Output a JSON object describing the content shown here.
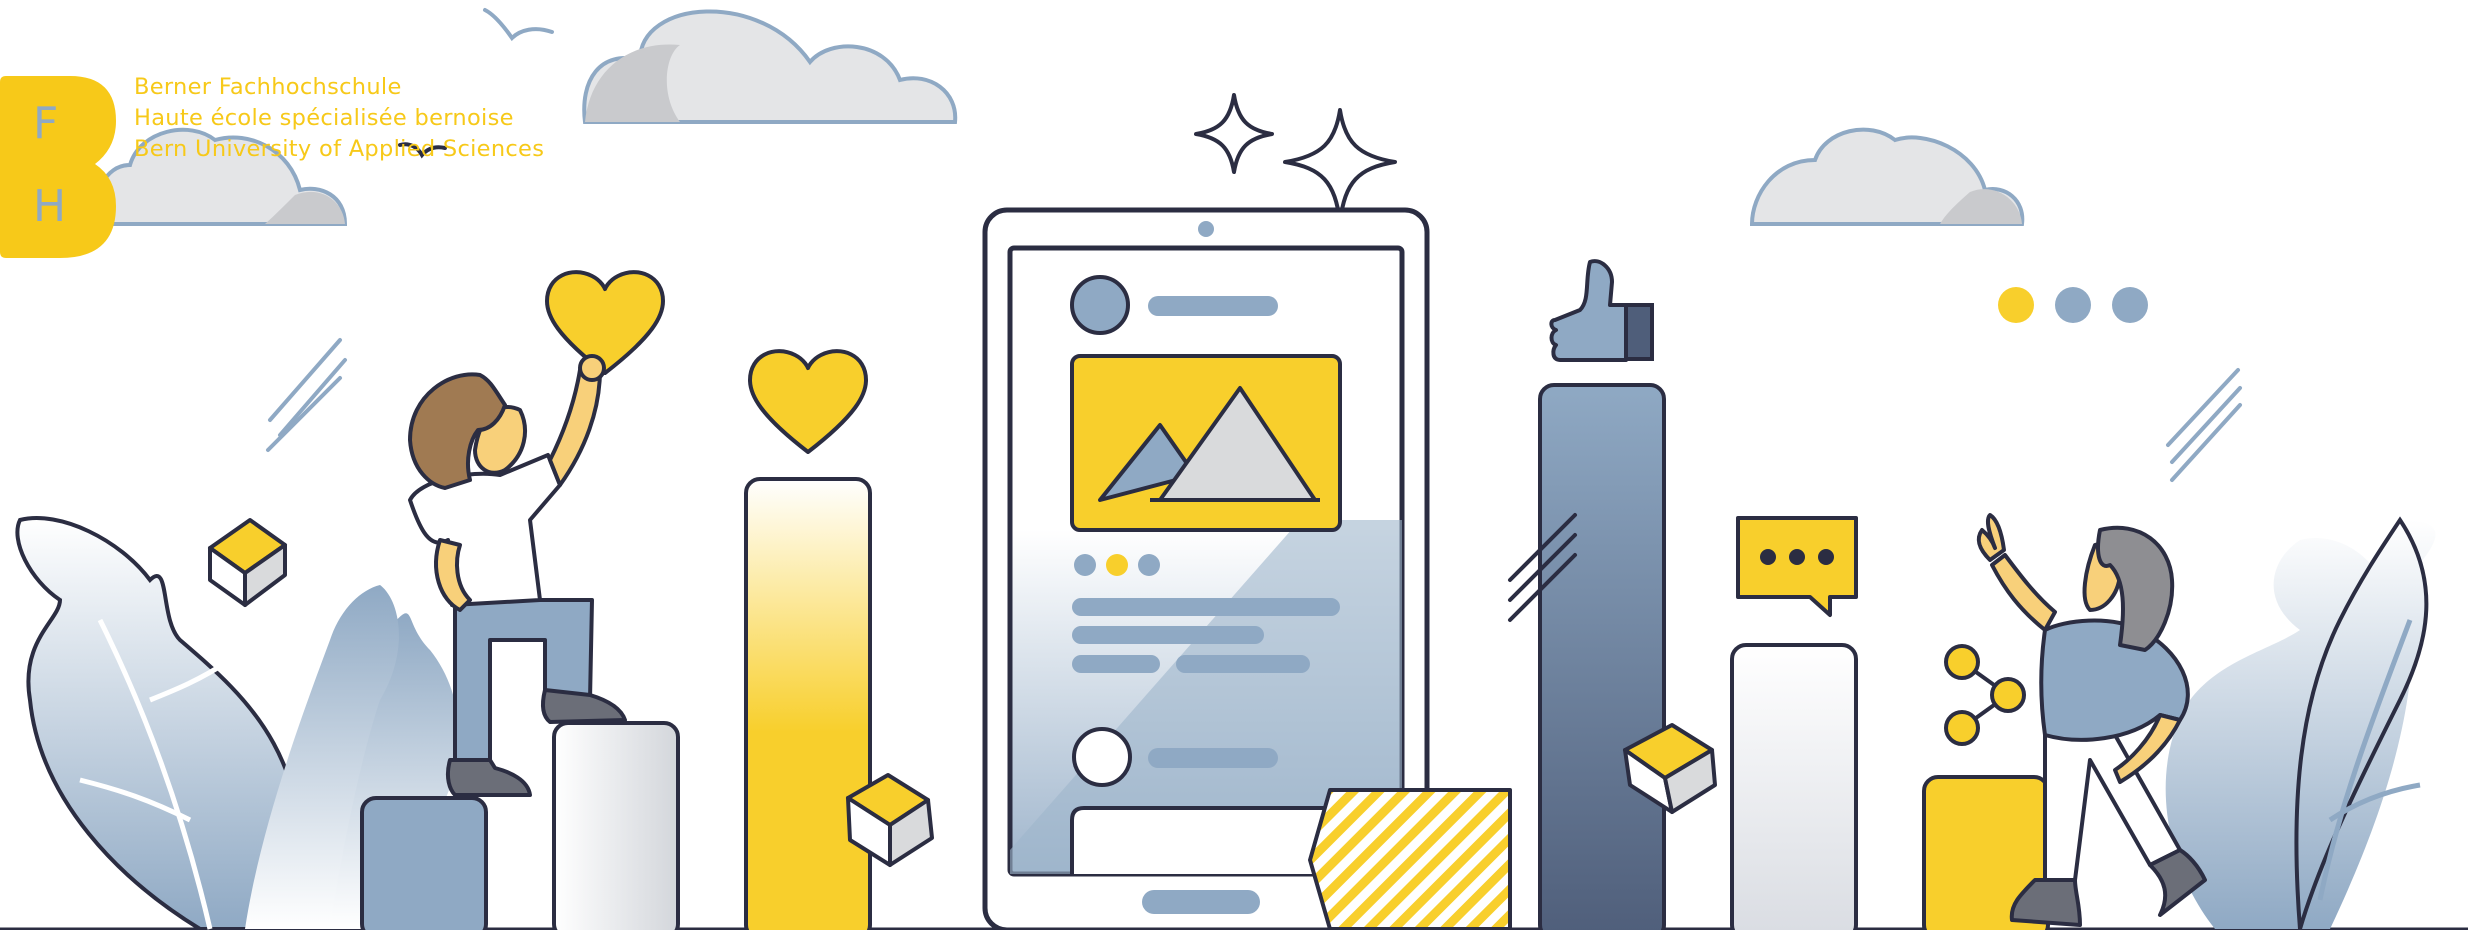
{
  "brand": {
    "letters": [
      "F",
      "H"
    ],
    "lines": [
      "Berner Fachhochschule",
      "Haute école spécialisée bernoise",
      "Bern University of Applied Sciences"
    ],
    "color": "#F7C919",
    "letter_color": "#8FA9C4"
  },
  "colors": {
    "yellow": "#F8CF2C",
    "blue": "#8FA9C4",
    "outline": "#2B2D42",
    "grey": "#D9DADC",
    "brown": "#A07A52"
  },
  "icons": [
    "heart-icon",
    "thumbs-up-icon",
    "chat-bubble-icon",
    "image-icon",
    "sparkle-icon",
    "network-icon",
    "cloud-icon",
    "bird-icon",
    "cube-icon"
  ]
}
